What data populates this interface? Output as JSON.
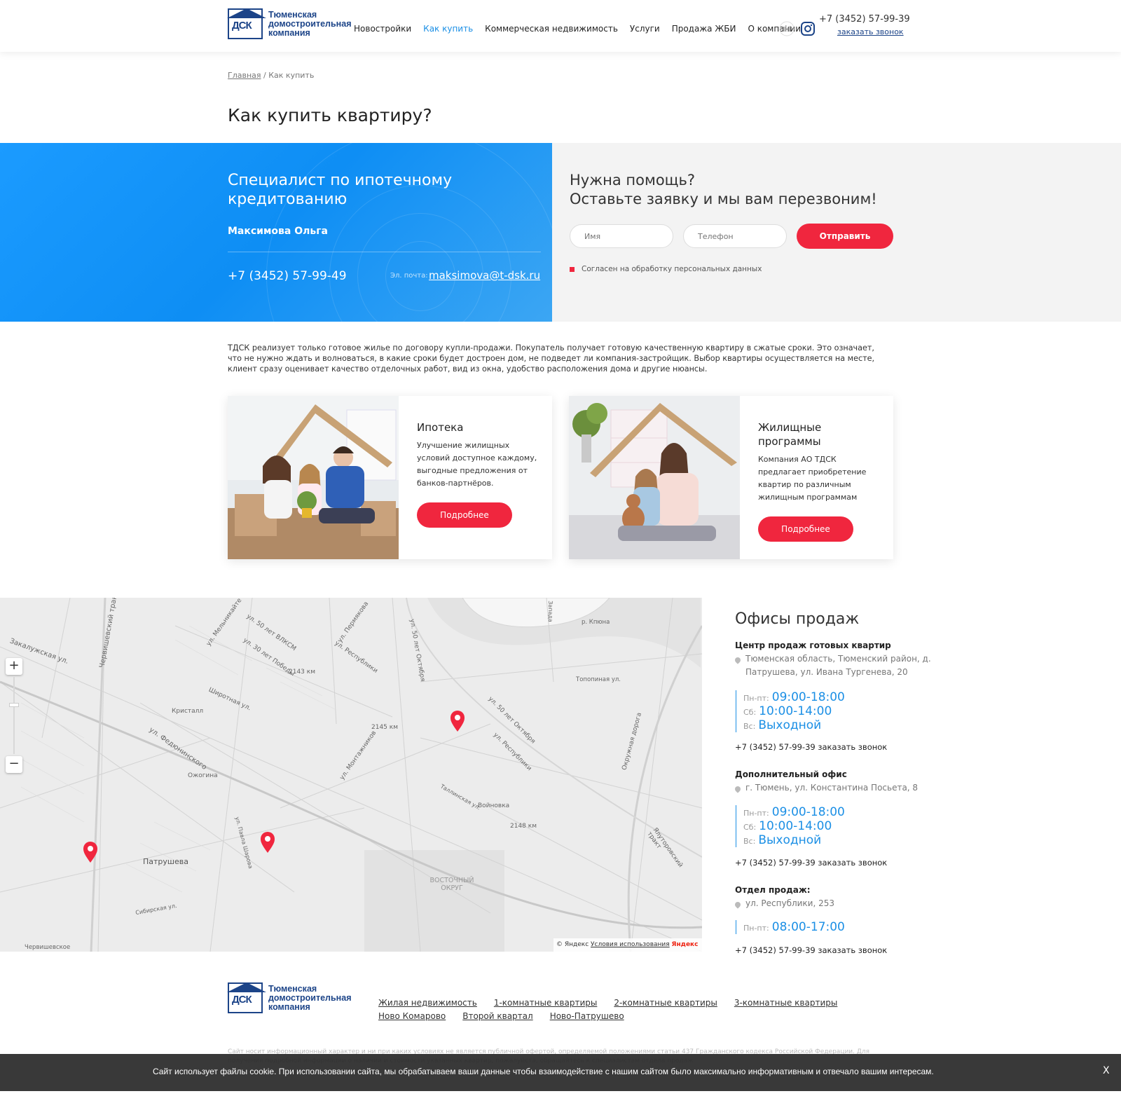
{
  "header": {
    "logo_line1": "Тюменская",
    "logo_line2": "домостроительная",
    "logo_line3": "компания",
    "logo_mark": "ДСК",
    "nav": [
      "Новостройки",
      "Как купить",
      "Коммерческая недвижимость",
      "Услуги",
      "Продажа ЖБИ",
      "О компании"
    ],
    "active_nav": "Как купить",
    "phone": "+7 (3452) 57-99-39",
    "callback": "заказать звонок",
    "icons": [
      "accessibility-chart-icon",
      "instagram-icon"
    ]
  },
  "breadcrumb": {
    "home": "Главная",
    "separator": "/",
    "current": "Как купить"
  },
  "page_title": "Как купить квартиру?",
  "hero": {
    "specialist_title": "Специалист по ипотечному кредитованию",
    "specialist_name": "Максимова Ольга",
    "specialist_phone": "+7 (3452) 57-99-49",
    "email_label": "Эл. почта:",
    "email": "maksimova@t-dsk.ru",
    "help_title_line1": "Нужна помощь?",
    "help_title_line2": "Оставьте заявку и мы вам перезвоним!",
    "name_placeholder": "Имя",
    "phone_placeholder": "Телефон",
    "submit": "Отправить",
    "consent": "Согласен на обработку персональных данных"
  },
  "intro": "ТДСК реализует только готовое жилье по договору купли-продажи. Покупатель получает готовую качественную квартиру в сжатые сроки. Это означает, что не нужно ждать и волноваться, в какие сроки будет достроен дом, не подведет ли компания-застройщик. Выбор квартиры осуществляется на месте, клиент сразу оценивает качество отделочных работ, вид из окна, удобство расположения дома и другие нюансы.",
  "cards": [
    {
      "title": "Ипотека",
      "text": "Улучшение жилищных условий доступное каждому, выгодные предложения от банков-партнёров.",
      "button": "Подробнее"
    },
    {
      "title": "Жилищные программы",
      "text": "Компания АО ТДСК предлагает приобретение квартир по различным жилищным программам",
      "button": "Подробнее"
    }
  ],
  "map": {
    "labels": [
      "Закалужская ул.",
      "Червишевский тракт",
      "ул. Мельникайте",
      "ул. 50 лет ВЛКСМ",
      "ул. 30 лет Победы",
      "2143 км",
      "ул. Республики",
      "ул. Пермякова",
      "ул. 50 лет Октября",
      "Кристалл",
      "Широтная ул.",
      "ул. Федюнинского",
      "2145 км",
      "ул. 50 лет Октября",
      "ул. Республики",
      "Ожогина",
      "ул. Монтажников",
      "Таллинская ул.",
      "Войновка",
      "2148 км",
      "Патрушева",
      "ул. Павла Шарова",
      "Сибирская ул.",
      "Червишевское",
      "Восточный округ",
      "Окружная дорога",
      "Ялуторовский тракт",
      "Топопиная ул.",
      "р. Кпюна",
      "Запада"
    ],
    "zoom_in": "+",
    "zoom_out": "−",
    "copyright": "© Яндекс",
    "terms": "Условия использования",
    "brand": "Яндекс"
  },
  "offices": {
    "title": "Офисы продаж",
    "list": [
      {
        "name": "Центр продаж готовых квартир",
        "address": "Тюменская область, Тюменский район, д. Патрушева, ул. Ивана Тургенева, 20",
        "schedule": [
          {
            "label": "Пн-пт:",
            "value": "09:00-18:00"
          },
          {
            "label": "Сб:",
            "value": "10:00-14:00"
          },
          {
            "label": "Вс:",
            "value": "Выходной"
          }
        ],
        "phone": "+7 (3452) 57-99-39",
        "callback": "заказать звонок"
      },
      {
        "name": "Дополнительный офис",
        "address": "г. Тюмень, ул. Константина Посьета, 8",
        "schedule": [
          {
            "label": "Пн-пт:",
            "value": "09:00-18:00"
          },
          {
            "label": "Сб:",
            "value": "10:00-14:00"
          },
          {
            "label": "Вс:",
            "value": "Выходной"
          }
        ],
        "phone": "+7 (3452) 57-99-39",
        "callback": "заказать звонок"
      },
      {
        "name": "Отдел продаж:",
        "address": "ул. Республики, 253",
        "schedule": [
          {
            "label": "Пн-пт:",
            "value": "08:00-17:00"
          }
        ],
        "phone": "+7 (3452) 57-99-39",
        "callback": "заказать звонок"
      }
    ]
  },
  "footer": {
    "links": [
      "Жилая недвижимость",
      "1-комнатные квартиры",
      "2-комнатные квартиры",
      "3-комнатные квартиры",
      "Ново Комарово",
      "Второй квартал",
      "Ново-Патрушево"
    ],
    "fine_print": "Сайт носит информационный характер и ни при каких условиях не является публичной офертой, определяемой положениями статьи 437 Гражданского кодекса Российской Федерации. Для получения подробной информации о наличии и стоимости указанных квартир, пожалуйста, обращайтесь к специалистам отдела продаж."
  },
  "cookie": {
    "text": "Сайт использует файлы cookie. При использовании сайта, мы обрабатываем ваши данные чтобы взаимодействие с нашим сайтом было максимально информативным и отвечало вашим интересам.",
    "close": "X"
  },
  "colors": {
    "accent": "#1b8fe5",
    "brand_blue": "#1c4488",
    "button_red": "#f0263e",
    "hero_blue": "#1b9bff"
  }
}
